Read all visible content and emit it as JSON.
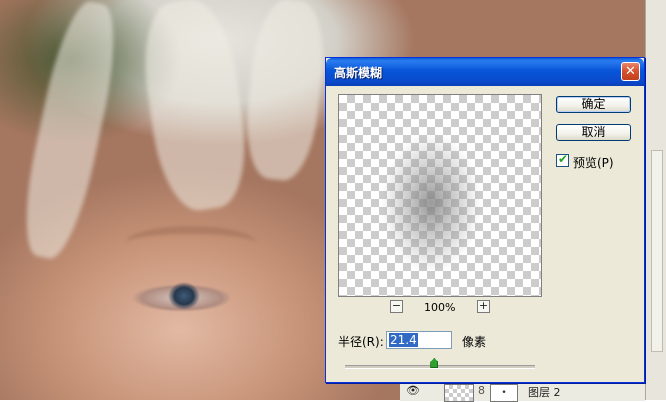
{
  "dialog": {
    "title": "高斯模糊",
    "close_glyph": "✕",
    "ok_label": "确定",
    "cancel_label": "取消",
    "preview_label": "预览(P)",
    "preview_checked": true,
    "zoom_minus": "−",
    "zoom_plus": "+",
    "zoom_level": "100%",
    "radius_label": "半径(R):",
    "radius_value": "21.4",
    "radius_unit": "像素",
    "slider_fraction": 0.47
  },
  "layers_panel": {
    "layer_name": "图层 2",
    "mask_text": "•"
  },
  "colors": {
    "titlebar_blue": "#0a49cc",
    "dialog_face": "#ece9d8",
    "checkbox_tick": "#21a121",
    "slider_thumb": "#2fa12f"
  },
  "icons": {
    "close": "close-icon",
    "visibility": "eye-icon",
    "link": "chain-link-icon"
  }
}
